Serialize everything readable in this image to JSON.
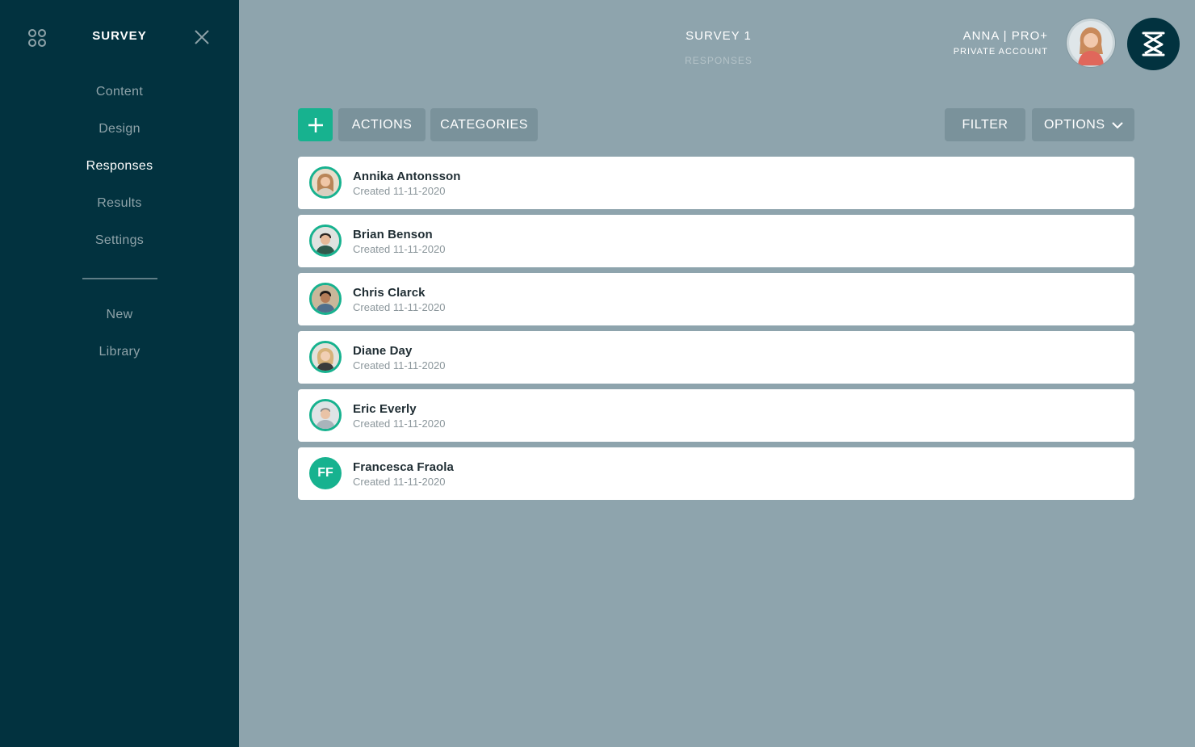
{
  "sidebar": {
    "title": "SURVEY",
    "items": [
      {
        "label": "Content",
        "active": false
      },
      {
        "label": "Design",
        "active": false
      },
      {
        "label": "Responses",
        "active": true
      },
      {
        "label": "Results",
        "active": false
      },
      {
        "label": "Settings",
        "active": false
      }
    ],
    "secondary": [
      {
        "label": "New"
      },
      {
        "label": "Library"
      }
    ]
  },
  "header": {
    "title": "SURVEY 1",
    "subtitle": "RESPONSES",
    "account_name": "ANNA | PRO+",
    "account_type": "PRIVATE ACCOUNT"
  },
  "toolbar": {
    "add_icon": "plus-icon",
    "actions_label": "ACTIONS",
    "categories_label": "CATEGORIES",
    "filter_label": "FILTER",
    "options_label": "OPTIONS"
  },
  "responses": [
    {
      "name": "Annika Antonsson",
      "created": "Created 11-11-2020",
      "initials": ""
    },
    {
      "name": "Brian Benson",
      "created": "Created 11-11-2020",
      "initials": ""
    },
    {
      "name": "Chris Clarck",
      "created": "Created 11-11-2020",
      "initials": ""
    },
    {
      "name": "Diane Day",
      "created": "Created 11-11-2020",
      "initials": ""
    },
    {
      "name": "Eric Everly",
      "created": "Created 11-11-2020",
      "initials": ""
    },
    {
      "name": "Francesca Fraola",
      "created": "Created 11-11-2020",
      "initials": "FF"
    }
  ],
  "colors": {
    "sidebar_bg": "#02323f",
    "page_bg": "#8ea4ad",
    "accent": "#17b28f",
    "button_bg": "#7a929b"
  }
}
